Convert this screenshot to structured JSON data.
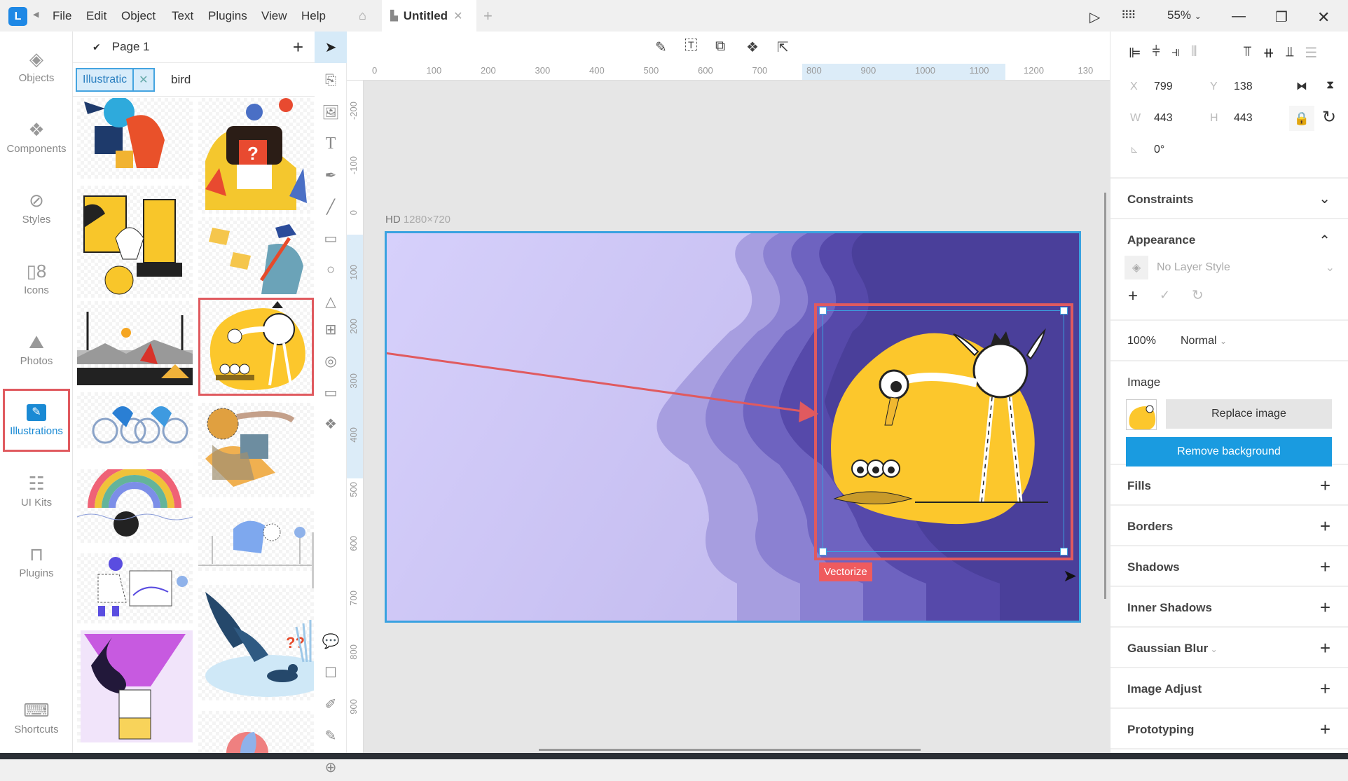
{
  "titlebar": {
    "logo": "L",
    "menu": [
      "File",
      "Edit",
      "Object",
      "Text",
      "Plugins",
      "View",
      "Help"
    ],
    "doc_tab": "Untitled",
    "zoom": "55%"
  },
  "rail": {
    "items": [
      {
        "label": "Objects",
        "icon": "layers-icon"
      },
      {
        "label": "Components",
        "icon": "components-icon"
      },
      {
        "label": "Styles",
        "icon": "styles-icon"
      },
      {
        "label": "Icons",
        "icon": "icons-icon"
      },
      {
        "label": "Photos",
        "icon": "photos-icon"
      },
      {
        "label": "Illustrations",
        "icon": "illustrations-icon",
        "active": true
      },
      {
        "label": "UI Kits",
        "icon": "ui-kits-icon"
      },
      {
        "label": "Plugins",
        "icon": "plugins-icon"
      },
      {
        "label": "Shortcuts",
        "icon": "keyboard-icon"
      }
    ]
  },
  "library": {
    "page": "Page 1",
    "filter_chip": "Illustratic",
    "search_value": "bird",
    "thumbnails": [
      "person-with-dog",
      "person-question-box",
      "turkey-door",
      "bird-with-pen",
      "winter-landscape",
      "stork-feeding-chicks",
      "cyclists",
      "runner-creature",
      "mermaid-rainbow",
      "person-with-board",
      "person-crouching",
      "hot-air-balloon",
      "eagle-duck",
      "beach-ball"
    ]
  },
  "canvas": {
    "artboard_name": "HD",
    "artboard_size": "1280×720",
    "ruler_h": [
      "0",
      "100",
      "200",
      "300",
      "400",
      "500",
      "600",
      "700",
      "800",
      "900",
      "1000",
      "1100",
      "1200",
      "130"
    ],
    "ruler_v": [
      "-200",
      "-100",
      "0",
      "100",
      "200",
      "300",
      "400",
      "500",
      "600",
      "700",
      "800",
      "900"
    ],
    "vectorize_label": "Vectorize"
  },
  "inspector": {
    "x_label": "X",
    "x": "799",
    "y_label": "Y",
    "y": "138",
    "w_label": "W",
    "w": "443",
    "h_label": "H",
    "h": "443",
    "rotation": "0°",
    "constraints": "Constraints",
    "appearance": "Appearance",
    "layer_style": "No Layer Style",
    "opacity": "100%",
    "blend": "Normal",
    "image_title": "Image",
    "replace_image": "Replace image",
    "remove_bg": "Remove background",
    "sections": [
      "Fills",
      "Borders",
      "Shadows",
      "Inner Shadows",
      "Gaussian Blur",
      "Image Adjust",
      "Prototyping"
    ]
  },
  "colors": {
    "accent": "#1a9be0",
    "highlight": "#e05a5f",
    "illustration_yellow": "#fcc72c",
    "artboard_purple": "#4a3f9a"
  }
}
